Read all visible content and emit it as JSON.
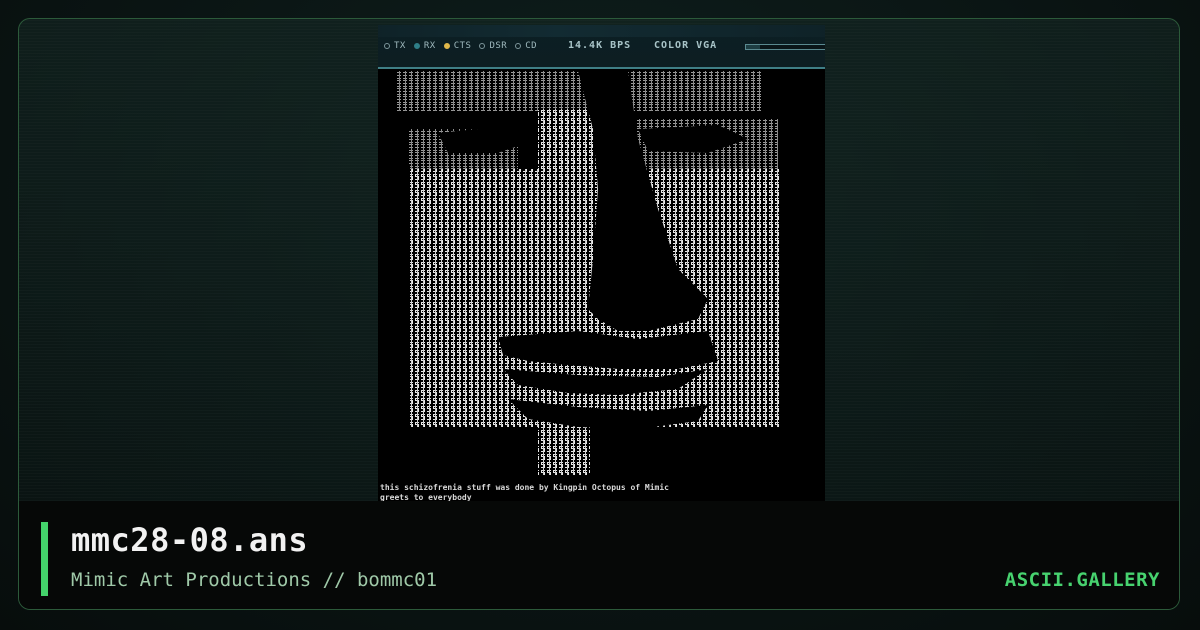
{
  "colors": {
    "accent": "#44d36b",
    "frame_border": "#2c5a3a",
    "background": "#0a1413",
    "title": "#f2f2f2",
    "subtitle": "#9fc9a8"
  },
  "preview": {
    "status_bar": {
      "indicators": [
        {
          "label": "TX",
          "state": "off",
          "color": "#7c959a"
        },
        {
          "label": "RX",
          "state": "on",
          "color": "#2f7f88"
        },
        {
          "label": "CTS",
          "state": "on",
          "color": "#e0b84a"
        },
        {
          "label": "DSR",
          "state": "off",
          "color": "#7c959a"
        },
        {
          "label": "CD",
          "state": "off",
          "color": "#7c959a"
        }
      ],
      "speed": "14.4K BPS",
      "color_mode": "COLOR VGA",
      "progress": 0.18
    },
    "credit_lines": [
      "this schizofrenia stuff was done by Kingpin Octopus of Mimic",
      "greets to everybody"
    ]
  },
  "file": {
    "name": "mmc28-08.ans",
    "subtitle": "Mimic Art Productions // bommc01"
  },
  "brand": "ASCII.GALLERY"
}
